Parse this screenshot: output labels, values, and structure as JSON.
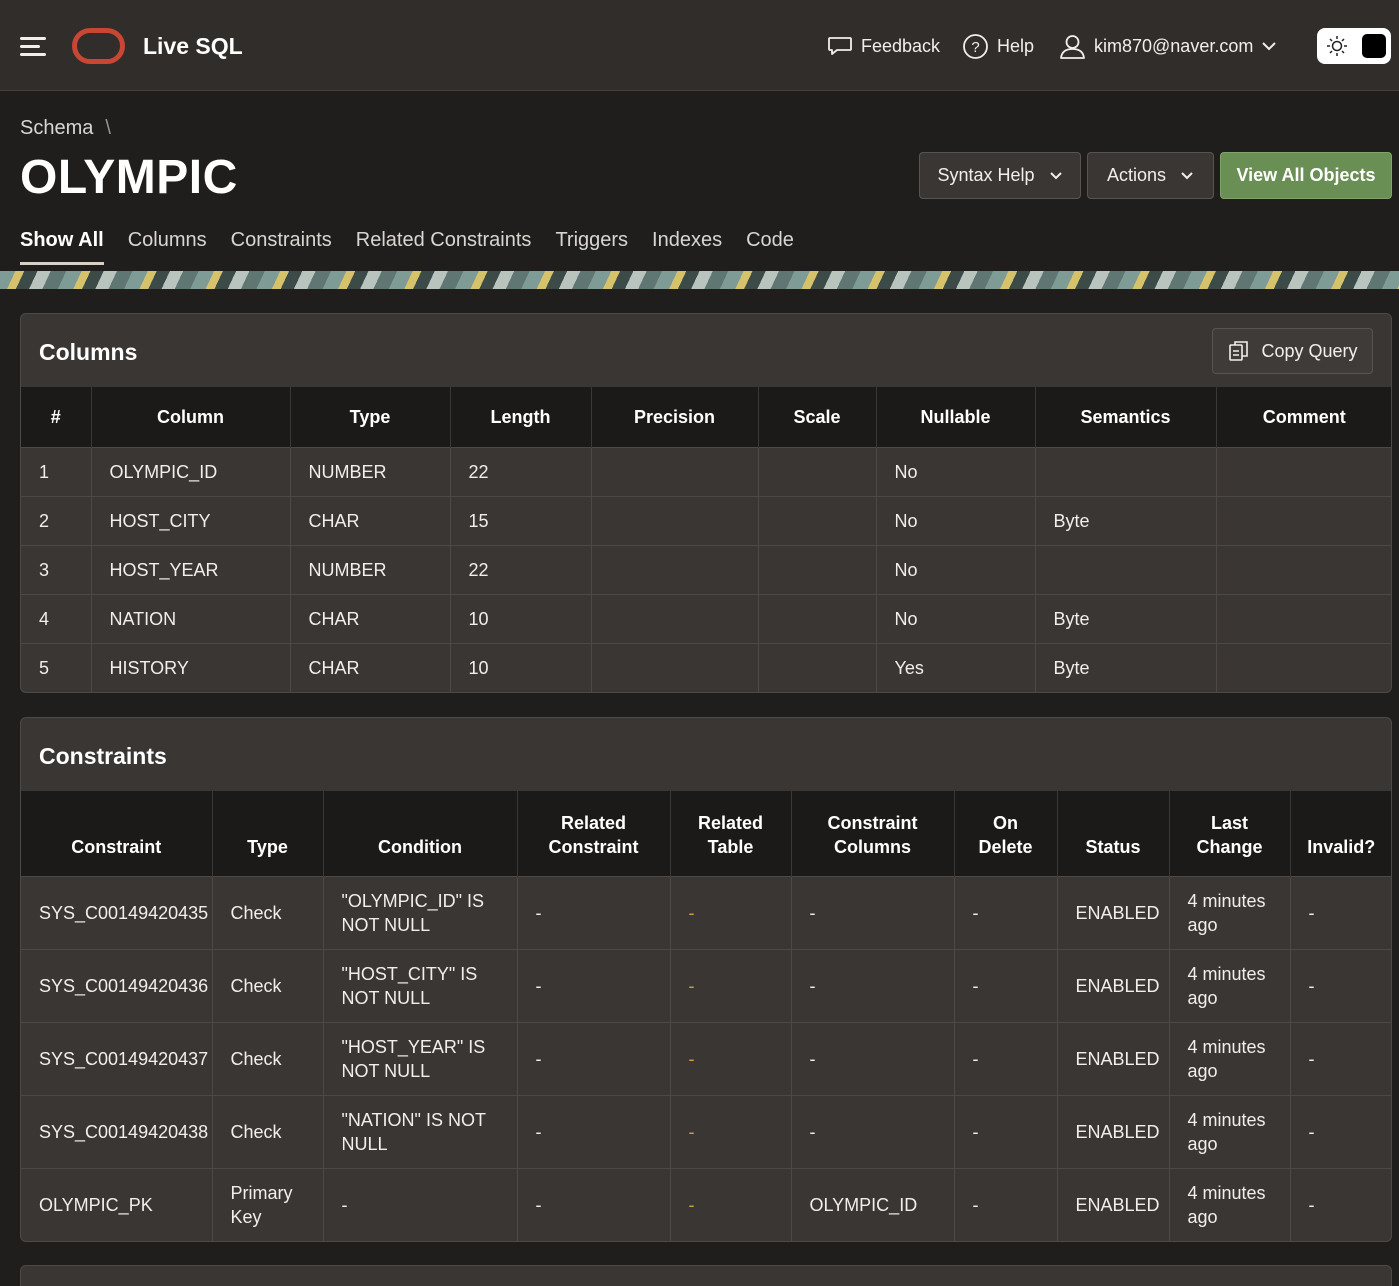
{
  "header": {
    "app_title": "Live SQL",
    "feedback_label": "Feedback",
    "help_label": "Help",
    "user_label": "kim870@naver.com"
  },
  "breadcrumb": {
    "parent": "Schema",
    "separator": "\\"
  },
  "page_title": "OLYMPIC",
  "buttons": {
    "syntax_help": "Syntax Help",
    "actions": "Actions",
    "view_all_objects": "View All Objects",
    "copy_query": "Copy Query"
  },
  "tabs": [
    "Show All",
    "Columns",
    "Constraints",
    "Related Constraints",
    "Triggers",
    "Indexes",
    "Code"
  ],
  "columns_panel": {
    "title": "Columns",
    "headers": [
      "#",
      "Column",
      "Type",
      "Length",
      "Precision",
      "Scale",
      "Nullable",
      "Semantics",
      "Comment"
    ],
    "rows": [
      [
        "1",
        "OLYMPIC_ID",
        "NUMBER",
        "22",
        "",
        "",
        "No",
        "",
        ""
      ],
      [
        "2",
        "HOST_CITY",
        "CHAR",
        "15",
        "",
        "",
        "No",
        "Byte",
        ""
      ],
      [
        "3",
        "HOST_YEAR",
        "NUMBER",
        "22",
        "",
        "",
        "No",
        "",
        ""
      ],
      [
        "4",
        "NATION",
        "CHAR",
        "10",
        "",
        "",
        "No",
        "Byte",
        ""
      ],
      [
        "5",
        "HISTORY",
        "CHAR",
        "10",
        "",
        "",
        "Yes",
        "Byte",
        ""
      ]
    ]
  },
  "constraints_panel": {
    "title": "Constraints",
    "headers": [
      [
        "Constraint"
      ],
      [
        "Type"
      ],
      [
        "Condition"
      ],
      [
        "Related",
        "Constraint"
      ],
      [
        "Related",
        "Table"
      ],
      [
        "Constraint",
        "Columns"
      ],
      [
        "On",
        "Delete"
      ],
      [
        "Status"
      ],
      [
        "Last",
        "Change"
      ],
      [
        "Invalid?"
      ]
    ],
    "rows": [
      [
        [
          "SYS_C00149420435"
        ],
        [
          "Check"
        ],
        [
          "\"OLYMPIC_ID\" IS",
          "NOT NULL"
        ],
        [
          "-"
        ],
        [
          "-"
        ],
        [
          "-"
        ],
        [
          "-"
        ],
        [
          "ENABLED"
        ],
        [
          "4 minutes",
          "ago"
        ],
        [
          "-"
        ]
      ],
      [
        [
          "SYS_C00149420436"
        ],
        [
          "Check"
        ],
        [
          "\"HOST_CITY\" IS",
          "NOT NULL"
        ],
        [
          "-"
        ],
        [
          "-"
        ],
        [
          "-"
        ],
        [
          "-"
        ],
        [
          "ENABLED"
        ],
        [
          "4 minutes",
          "ago"
        ],
        [
          "-"
        ]
      ],
      [
        [
          "SYS_C00149420437"
        ],
        [
          "Check"
        ],
        [
          "\"HOST_YEAR\" IS",
          "NOT NULL"
        ],
        [
          "-"
        ],
        [
          "-"
        ],
        [
          "-"
        ],
        [
          "-"
        ],
        [
          "ENABLED"
        ],
        [
          "4 minutes",
          "ago"
        ],
        [
          "-"
        ]
      ],
      [
        [
          "SYS_C00149420438"
        ],
        [
          "Check"
        ],
        [
          "\"NATION\" IS NOT",
          "NULL"
        ],
        [
          "-"
        ],
        [
          "-"
        ],
        [
          "-"
        ],
        [
          "-"
        ],
        [
          "ENABLED"
        ],
        [
          "4 minutes",
          "ago"
        ],
        [
          "-"
        ]
      ],
      [
        [
          "OLYMPIC_PK"
        ],
        [
          "Primary",
          "Key"
        ],
        [
          "-"
        ],
        [
          "-"
        ],
        [
          "-"
        ],
        [
          "OLYMPIC_ID"
        ],
        [
          "-"
        ],
        [
          "ENABLED"
        ],
        [
          "4 minutes",
          "ago"
        ],
        [
          "-"
        ]
      ]
    ]
  },
  "colors": {
    "header_bg": "#312d2a",
    "page_bg": "#201e1c",
    "panel_bg": "#3a3633",
    "brand_red": "#c74634",
    "accent_green": "#6a8f55",
    "link_dash_yellow": "#c9a640"
  },
  "icons": [
    "hamburger-icon",
    "oracle-logo",
    "feedback-icon",
    "help-icon",
    "user-icon",
    "chevron-down-icon",
    "sun-icon",
    "copy-icon"
  ]
}
